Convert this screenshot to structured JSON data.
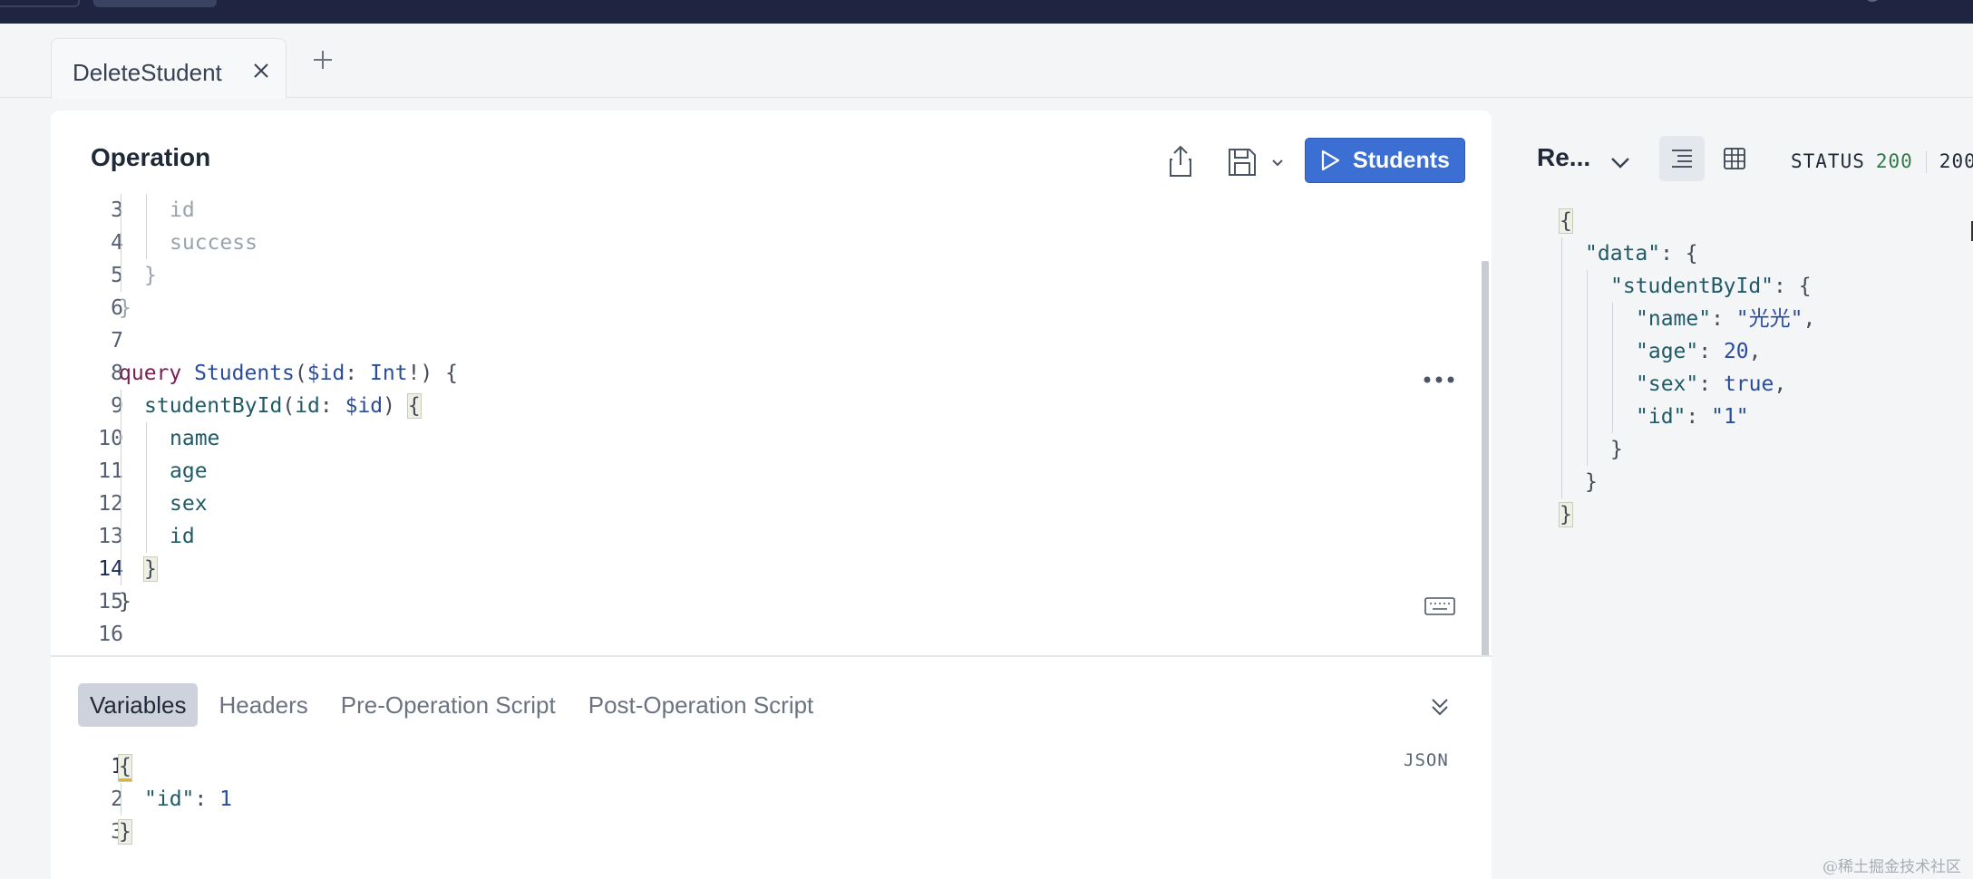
{
  "tabs": {
    "active_tab": "DeleteStudent",
    "new_tab_icon": "plus-icon",
    "close_icon": "close-icon"
  },
  "operation": {
    "title": "Operation",
    "share_icon": "share-icon",
    "save_icon": "save-icon",
    "run_button_label": "Students",
    "lines": [
      {
        "n": "3",
        "tokens": [
          {
            "t": "id",
            "c": "t-dim"
          }
        ],
        "indent": 2
      },
      {
        "n": "4",
        "tokens": [
          {
            "t": "success",
            "c": "t-dim"
          }
        ],
        "indent": 2
      },
      {
        "n": "5",
        "tokens": [
          {
            "t": "}",
            "c": "t-dim"
          }
        ],
        "indent": 1
      },
      {
        "n": "6",
        "tokens": [
          {
            "t": "}",
            "c": "t-dim"
          }
        ],
        "indent": 0
      },
      {
        "n": "7",
        "tokens": [],
        "indent": 0
      },
      {
        "n": "8",
        "tokens": [
          {
            "t": "query",
            "c": "t-kw"
          },
          {
            "t": " ",
            "c": ""
          },
          {
            "t": "Students",
            "c": "t-op"
          },
          {
            "t": "(",
            "c": "t-punc"
          },
          {
            "t": "$id",
            "c": "t-var"
          },
          {
            "t": ": ",
            "c": "t-punc"
          },
          {
            "t": "Int",
            "c": "t-type"
          },
          {
            "t": "!) {",
            "c": "t-punc"
          }
        ],
        "indent": 0
      },
      {
        "n": "9",
        "tokens": [
          {
            "t": "studentById",
            "c": "t-field"
          },
          {
            "t": "(",
            "c": "t-punc"
          },
          {
            "t": "id",
            "c": "t-field"
          },
          {
            "t": ": ",
            "c": "t-punc"
          },
          {
            "t": "$id",
            "c": "t-var"
          },
          {
            "t": ") ",
            "c": "t-punc"
          },
          {
            "t": "{",
            "c": "t-punc brace-hl"
          }
        ],
        "indent": 1
      },
      {
        "n": "10",
        "tokens": [
          {
            "t": "name",
            "c": "t-field"
          }
        ],
        "indent": 2
      },
      {
        "n": "11",
        "tokens": [
          {
            "t": "age",
            "c": "t-field"
          }
        ],
        "indent": 2
      },
      {
        "n": "12",
        "tokens": [
          {
            "t": "sex",
            "c": "t-field"
          }
        ],
        "indent": 2
      },
      {
        "n": "13",
        "tokens": [
          {
            "t": "id",
            "c": "t-field"
          }
        ],
        "indent": 2
      },
      {
        "n": "14",
        "tokens": [
          {
            "t": "}",
            "c": "t-punc brace-hl"
          }
        ],
        "indent": 1,
        "current": true
      },
      {
        "n": "15",
        "tokens": [
          {
            "t": "}",
            "c": "t-punc"
          }
        ],
        "indent": 0
      },
      {
        "n": "16",
        "tokens": [],
        "indent": 0
      }
    ],
    "more_icon": "more-horizontal-icon",
    "keyboard_icon": "keyboard-icon"
  },
  "variables_panel": {
    "tabs": [
      "Variables",
      "Headers",
      "Pre-Operation Script",
      "Post-Operation Script"
    ],
    "active_tab": "Variables",
    "collapse_icon": "chevrons-down-icon",
    "format_label": "JSON",
    "lines": [
      {
        "n": "1",
        "tokens": [
          {
            "t": "{",
            "c": "t-punc brace-hl brace-yellow"
          }
        ],
        "indent": 0,
        "current": true
      },
      {
        "n": "2",
        "tokens": [
          {
            "t": "\"id\"",
            "c": "t-key"
          },
          {
            "t": ": ",
            "c": "t-punc"
          },
          {
            "t": "1",
            "c": "t-num"
          }
        ],
        "indent": 1
      },
      {
        "n": "3",
        "tokens": [
          {
            "t": "}",
            "c": "t-punc brace-hl"
          }
        ],
        "indent": 0
      }
    ]
  },
  "response": {
    "title": "Re...",
    "dropdown_icon": "chevron-down-icon",
    "view_text_icon": "align-left-icon",
    "view_table_icon": "table-icon",
    "status_label": "STATUS",
    "status_code": "200",
    "status_extra": "200",
    "lines": [
      {
        "tokens": [
          {
            "t": "{",
            "c": "t-punc resp-hl"
          }
        ],
        "indent": 0
      },
      {
        "tokens": [
          {
            "t": "\"data\"",
            "c": "t-key"
          },
          {
            "t": ": {",
            "c": "t-punc"
          }
        ],
        "indent": 1
      },
      {
        "tokens": [
          {
            "t": "\"studentById\"",
            "c": "t-key"
          },
          {
            "t": ": {",
            "c": "t-punc"
          }
        ],
        "indent": 2
      },
      {
        "tokens": [
          {
            "t": "\"name\"",
            "c": "t-key"
          },
          {
            "t": ": ",
            "c": "t-punc"
          },
          {
            "t": "\"光光\"",
            "c": "t-str"
          },
          {
            "t": ",",
            "c": "t-punc"
          }
        ],
        "indent": 3
      },
      {
        "tokens": [
          {
            "t": "\"age\"",
            "c": "t-key"
          },
          {
            "t": ": ",
            "c": "t-punc"
          },
          {
            "t": "20",
            "c": "t-num"
          },
          {
            "t": ",",
            "c": "t-punc"
          }
        ],
        "indent": 3
      },
      {
        "tokens": [
          {
            "t": "\"sex\"",
            "c": "t-key"
          },
          {
            "t": ": ",
            "c": "t-punc"
          },
          {
            "t": "true",
            "c": "t-bool"
          },
          {
            "t": ",",
            "c": "t-punc"
          }
        ],
        "indent": 3
      },
      {
        "tokens": [
          {
            "t": "\"id\"",
            "c": "t-key"
          },
          {
            "t": ": ",
            "c": "t-punc"
          },
          {
            "t": "\"1\"",
            "c": "t-str"
          }
        ],
        "indent": 3
      },
      {
        "tokens": [
          {
            "t": "}",
            "c": "t-punc"
          }
        ],
        "indent": 2
      },
      {
        "tokens": [
          {
            "t": "}",
            "c": "t-punc"
          }
        ],
        "indent": 1
      },
      {
        "tokens": [
          {
            "t": "}",
            "c": "t-punc resp-hl"
          }
        ],
        "indent": 0
      }
    ]
  },
  "watermark": "@稀土掘金技术社区",
  "colors": {
    "topbar": "#1f2540",
    "run_button": "#3b6fd4",
    "status_ok": "#2f7a48"
  }
}
